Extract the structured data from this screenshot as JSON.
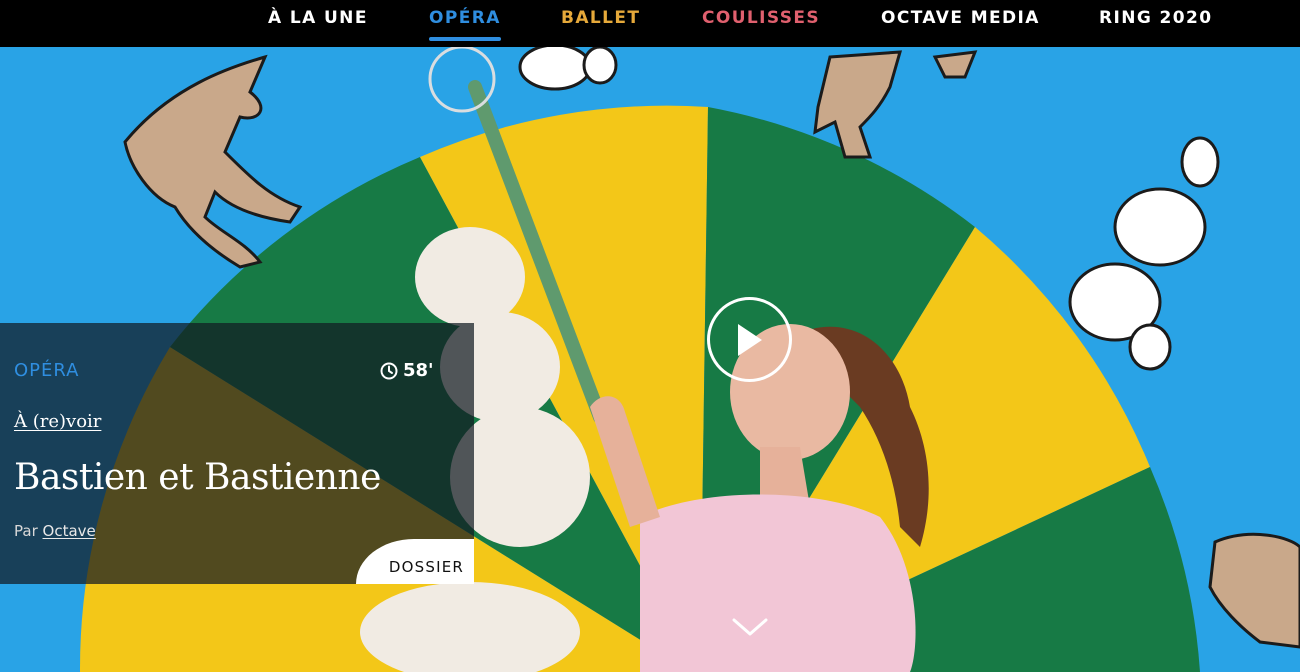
{
  "nav": {
    "items": [
      {
        "label": "À LA UNE",
        "color": "#ffffff"
      },
      {
        "label": "OPÉRA",
        "color": "#2f8ee0",
        "active": true
      },
      {
        "label": "BALLET",
        "color": "#e6a93a"
      },
      {
        "label": "COULISSES",
        "color": "#e0606e"
      },
      {
        "label": "OCTAVE MEDIA",
        "color": "#ffffff"
      },
      {
        "label": "RING 2020",
        "color": "#ffffff"
      }
    ]
  },
  "card": {
    "category": "OPÉRA",
    "category_color": "#2f8ee0",
    "duration": "58'",
    "rewatch": "À (re)voir",
    "title": "Bastien et Bastienne",
    "byline_prefix": "Par",
    "author": "Octave",
    "dossier": "DOSSIER"
  },
  "icons": {
    "clock": "clock-icon",
    "play": "play-icon",
    "scroll": "chevron-down-icon"
  },
  "colors": {
    "stage_blue": "#29a3e6",
    "wheel_yellow": "#f3c718",
    "wheel_green": "#177a45"
  }
}
